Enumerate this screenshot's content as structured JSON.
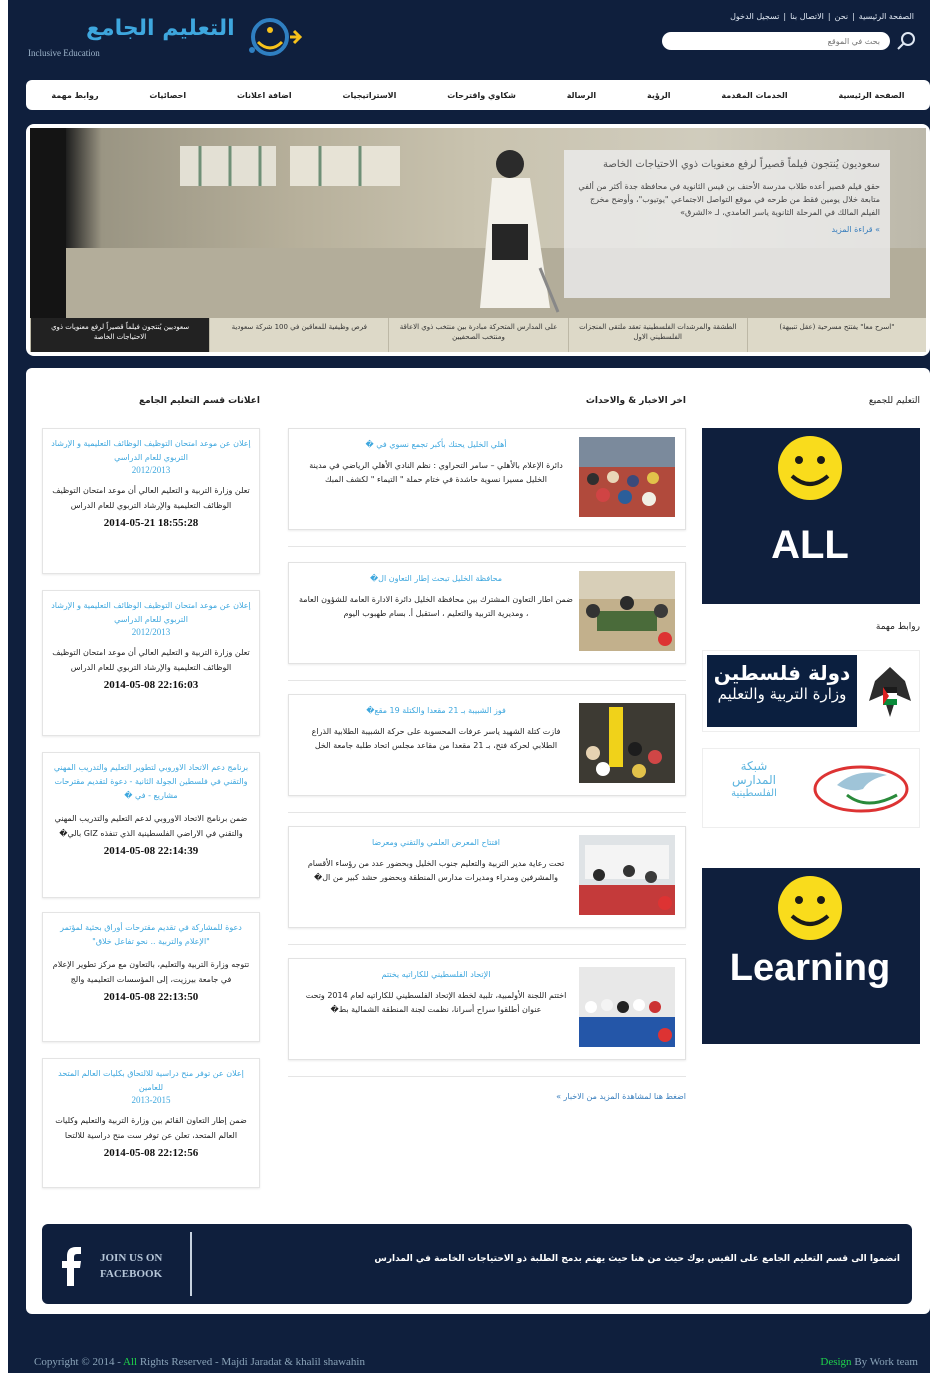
{
  "brand": {
    "logo_text": "التعليم الجامع",
    "logo_sub": "Inclusive Education"
  },
  "toplinks": [
    "الصفحة الرئيسية",
    "نحن",
    "الاتصال بنا",
    "تسجيل الدخول"
  ],
  "search": {
    "placeholder": "بحث في الموقع"
  },
  "nav": [
    "الصفحة الرئيسية",
    "الخدمات المقدمة",
    "الرؤية",
    "الرسالة",
    "شكاوي واقترحات",
    "الاستراتيجيات",
    "اضافة اعلانات",
    "احصائيات",
    "روابط مهمة"
  ],
  "slider": {
    "caption_title": "سعوديون يُنتجون فيلماً قصيراً لرفع معنويات ذوي الاحتياجات الخاصة",
    "caption_body": "حقق فيلم قصير أعده طلاب مدرسة الأحنف بن قيس الثانوية في محافظة جدة أكثر من ألفي متابعة خلال يومين فقط من طرحه في موقع التواصل الاجتماعي \"يوتيوب\"، وأوضح مخرج الفيلم المالك في المرحلة الثانوية ياسر العامدي، لـ «الشرق»",
    "read_more": "» قراءة المزيد",
    "thumbs": [
      "\"اسرح معا\" يفتتح مسرحية (عقل تنبيهة)",
      "الطشقة والمرشدات الفلسطينية تعقد ملتقى المنجزات الفلسطيني الاول",
      "على المدارس المتحركة مبادرة بين منتخب ذوي الاعاقة ومنتخب الصحفيين",
      "فرص وظيفية للمعاقين في 100 شركة سعودية",
      "سعوديين يُنتجون فيلماً قصيراً لرفع معنويات ذوي الاحتياجات الخاصة"
    ]
  },
  "columns": {
    "announcements_title": "اعلانات قسم التعليم الجامع",
    "news_title": "اخر الاخبار & والاحداث",
    "side_title": "التعليم للجميع",
    "links_title": "روابط مهمة"
  },
  "announcements": [
    {
      "title": "إعلان عن موعد امتحان التوظيف الوظائف التعليمية و الإرشاد التربوي للعام الدراسي",
      "year": "2012/2013",
      "body": "تعلن وزارة التربية و التعليم العالي أن موعد امتحان التوظيف الوظائف التعليمية والإرشاد التربوي للعام الدراس",
      "date": "2014-05-21 18:55:28"
    },
    {
      "title": "إعلان عن موعد امتحان التوظيف الوظائف التعليمية و الإرشاد التربوي للعام الدراسي",
      "year": "2012/2013",
      "body": "تعلن وزارة التربية و التعليم العالي أن موعد امتحان التوظيف الوظائف التعليمية والإرشاد التربوي للعام الدراس",
      "date": "2014-05-08 22:16:03"
    },
    {
      "title": "برنامج دعم الاتحاد الاوروبي لتطوير التعليم والتدريب المهني والتقني في فلسطين الجولة الثانية - دعوة لتقديم مقترحات مشاريع - في �",
      "year": "",
      "body": "ضمن برنامج الاتحاد الاوروبي لدعم التعليم والتدريب المهني والتقني في الاراضي الفلسطينية الذي تنفذه GIZ بالي�",
      "date": "2014-05-08 22:14:39"
    },
    {
      "title": "دعوة للمشاركة في تقديم مقترحات أوراق بحثية لمؤتمر \"الإعلام والتربية .. نحو تفاعل خلاق\"",
      "year": "",
      "body": "تتوجه وزارة التربية والتعليم، بالتعاون مع مركز تطوير الإعلام في جامعة بيرزيت، إلى المؤسسات التعليمية والج",
      "date": "2014-05-08 22:13:50"
    },
    {
      "title": "إعلان عن توفر منح دراسية للالتحاق بكليات العالم المتحد للعامين",
      "year": "2013-2015",
      "body": "ضمن إطار التعاون القائم بين وزارة التربية والتعليم وكليات العالم المتحد، تعلن عن توفر ست منح دراسية للالتحا",
      "date": "2014-05-08 22:12:56"
    }
  ],
  "news": [
    {
      "title": "أهلي الخليل يحتك بأكبر تجمع نسوي في �",
      "body": "دائرة الإعلام بالأهلي – سامر التحراوي : نظم النادي الأهلي الرياضي في مدينة الخليل مسيرا نسوية حاشدة في ختام حملة \" التيماء \" لكشف المبك"
    },
    {
      "title": "محافظة الخليل تبحث إطار التعاون ال�",
      "body": "ضمن اطار التعاون المشترك بين محافظة الخليل دائرة الادارة العامة للشؤون العامة ، ومديرية التربية والتعليم ، استقبل أ. بسام طهبوب اليوم"
    },
    {
      "title": "فوز الشبيبة بـ 21 مقعدا والكتلة 19 مقع�",
      "body": "فازت كتلة الشهيد ياسر عرفات المحسوبة على حركة الشبيبة الطلابية الذراع الطلابي لحركة فتح، بـ 21 مقعدا من مقاعد مجلس اتحاد طلبة جامعة الخل"
    },
    {
      "title": "افتتاح المعرض العلمي والتقني ومعرضا",
      "body": "تحت رعاية مدير التربية والتعليم جنوب الخليل وبحضور عدد من رؤساء الأقسام والمشرفين ومدراء ومديرات مدارس المنطقة وبحضور حشد كبير من ال�"
    },
    {
      "title": "الإتحاد الفلسطيني للكاراتيه يختتم",
      "body": "اختتم اللجنة الأولمبية، تلبية لخطة الإتحاد الفلسطيني للكاراتيه لعام 2014 وتحت عنوان أطلقوا سراح أسرانا، نظمت لجنة المنطقة الشمالية بط�"
    }
  ],
  "more_news": "اضغط هنا لمشاهدة المزيد من الاخبار »",
  "side": {
    "all_label": "ALL",
    "learning_label": "Learning",
    "palestine_top": "دولة فلسطين",
    "palestine_bottom": "وزارة التربية والتعليم",
    "network_top": "شبكة",
    "network_mid": "المدارس",
    "network_bottom": "الفلسطينية"
  },
  "footer": {
    "facebook_text": "انضموا الى قسم التعليم الجامع على الفيس بوك حيث من هنا حيث يهتم بدمج الطلبة ذو الاحتياجات الخاصة في المدارس",
    "join_line1": "JOIN US ON",
    "join_line2": "FACEBOOK",
    "copyright_pre": "Copyright © 2014 - ",
    "copyright_hl": "All",
    "copyright_post": " Rights Reserved - Majdi Jaradat & khalil shawahin",
    "design_hl": "Design",
    "design_post": " By Work team"
  },
  "colors": {
    "navy": "#0f1f3d",
    "accent": "#3ea7de",
    "green": "#1fd24a"
  }
}
